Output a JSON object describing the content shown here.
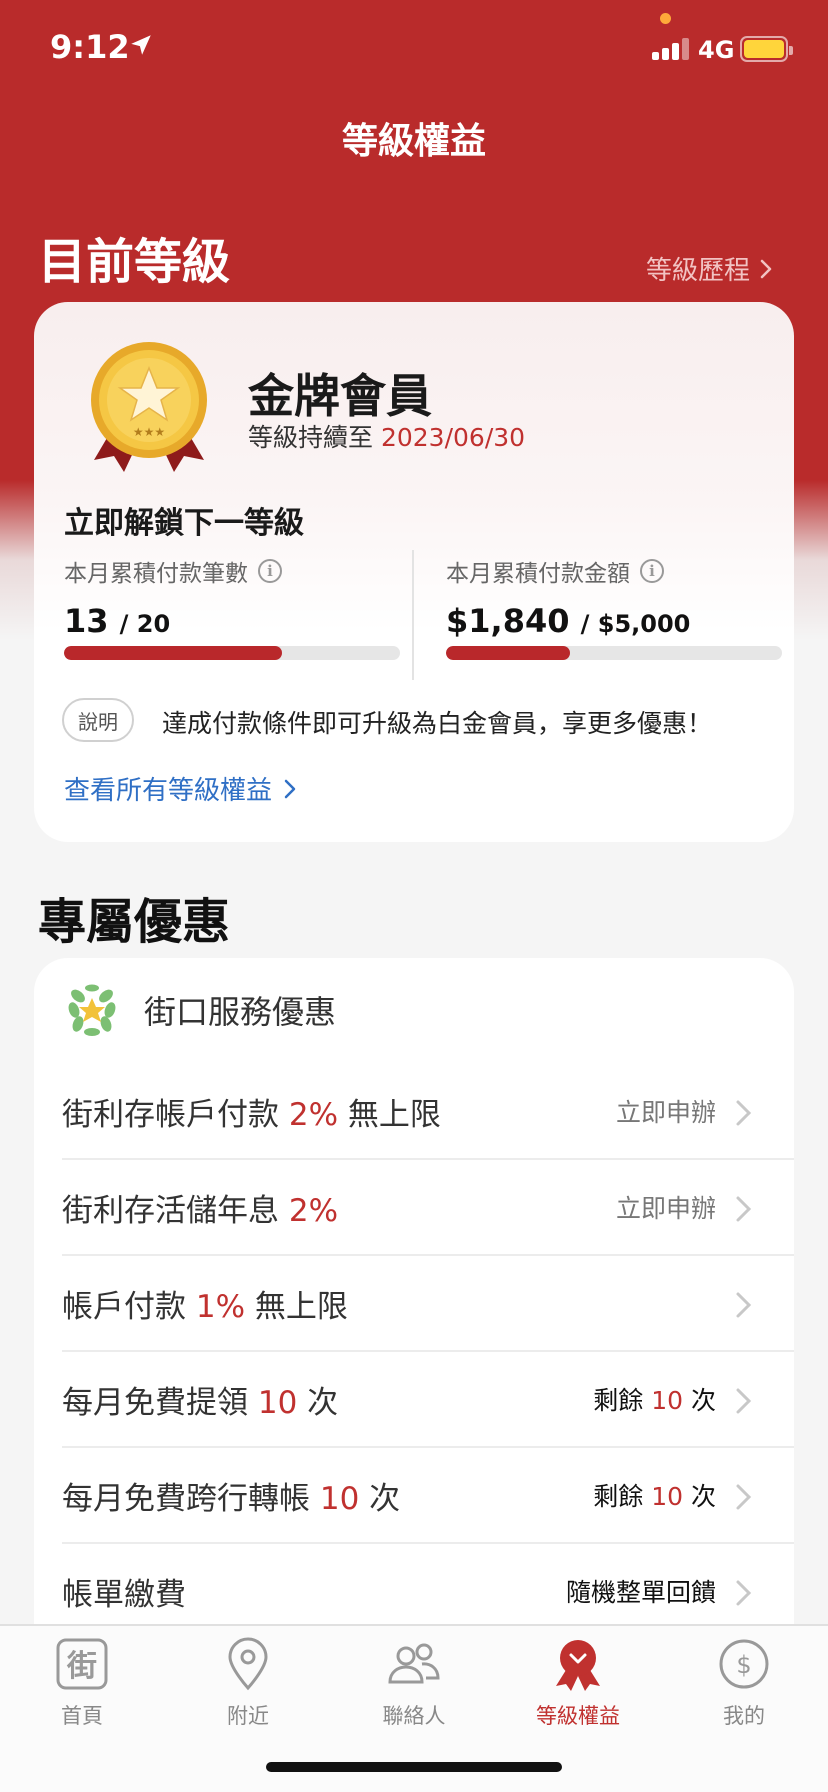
{
  "status_bar": {
    "time": "9:12",
    "network": "4G"
  },
  "page_title": "等級權益",
  "current_level": {
    "section_title": "目前等級",
    "history_link": "等級歷程",
    "tier_name": "金牌會員",
    "valid_prefix": "等級持續至",
    "valid_date": "2023/06/30",
    "unlock_title": "立即解鎖下一等級",
    "stats": [
      {
        "label": "本月累積付款筆數",
        "value": "13",
        "total": "/ 20",
        "progress": 0.65
      },
      {
        "label": "本月累積付款金額",
        "value": "$1,840",
        "total": "/ $5,000",
        "progress": 0.368
      }
    ],
    "note_label": "說明",
    "note_text": "達成付款條件即可升級為白金會員，享更多優惠！",
    "all_benefits_link": "查看所有等級權益"
  },
  "exclusive": {
    "section_title": "專屬優惠",
    "card_title": "街口服務優惠",
    "rows": [
      {
        "pre": "街利存帳戶付款 ",
        "hl": "2%",
        "post": " 無上限",
        "action": "立即申辦",
        "action_hl": "",
        "action_post": ""
      },
      {
        "pre": "街利存活儲年息 ",
        "hl": "2%",
        "post": "",
        "action": "立即申辦",
        "action_hl": "",
        "action_post": ""
      },
      {
        "pre": "帳戶付款 ",
        "hl": "1%",
        "post": " 無上限",
        "action": "",
        "action_hl": "",
        "action_post": ""
      },
      {
        "pre": "每月免費提領 ",
        "hl": "10",
        "post": " 次",
        "action": "剩餘 ",
        "action_hl": "10",
        "action_post": " 次"
      },
      {
        "pre": "每月免費跨行轉帳 ",
        "hl": "10",
        "post": " 次",
        "action": "剩餘 ",
        "action_hl": "10",
        "action_post": " 次"
      },
      {
        "pre": "帳單繳費",
        "hl": "",
        "post": "",
        "action": "隨機整單回饋",
        "action_hl": "",
        "action_post": ""
      }
    ]
  },
  "tabs": [
    {
      "label": "首頁",
      "icon": "jkos-logo-icon"
    },
    {
      "label": "附近",
      "icon": "location-pin-icon"
    },
    {
      "label": "聯絡人",
      "icon": "contacts-icon"
    },
    {
      "label": "等級權益",
      "icon": "medal-icon",
      "active": true
    },
    {
      "label": "我的",
      "icon": "dollar-circle-icon"
    }
  ],
  "colors": {
    "brand_red": "#b92b2b",
    "highlight": "#c0312f",
    "link_blue": "#2f6fc5"
  }
}
